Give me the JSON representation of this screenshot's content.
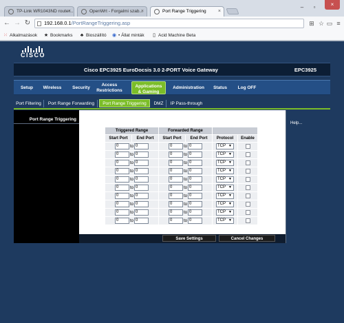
{
  "browser": {
    "tabs": [
      {
        "label": "TP-Link WR1043ND router..."
      },
      {
        "label": "OpenWrt - Forgalmi szab..."
      },
      {
        "label": "Port Range Triggering"
      }
    ],
    "url_host": "192.168.0.1",
    "url_path": "/PortRangeTriggering.asp",
    "bookmarks": [
      "Alkalmazások",
      "Bookmarks",
      "Bioszállító",
      "• Állat minták",
      "Acid Machine Beta"
    ]
  },
  "header": {
    "title": "Cisco EPC3925 EuroDocsis 3.0 2-PORT Voice Gateway",
    "model": "EPC3925",
    "logo": "CISCO"
  },
  "main_nav": [
    {
      "line1": "Setup",
      "line2": ""
    },
    {
      "line1": "Wireless",
      "line2": ""
    },
    {
      "line1": "Security",
      "line2": ""
    },
    {
      "line1": "Access",
      "line2": "Restrictions"
    },
    {
      "line1": "Applications",
      "line2": "& Gaming"
    },
    {
      "line1": "Administration",
      "line2": ""
    },
    {
      "line1": "Status",
      "line2": ""
    },
    {
      "line1": "Log OFF",
      "line2": ""
    }
  ],
  "sub_nav": [
    "Port Filtering",
    "Port Range Forwarding",
    "Port Range Triggering",
    "DMZ",
    "IP Pass-through"
  ],
  "section_title": "Port Range Triggering",
  "help": "Help...",
  "table": {
    "group_headers": [
      "Triggered Range",
      "Forwarded Range"
    ],
    "columns": [
      "Start Port",
      "End Port",
      "Start Port",
      "End Port",
      "Protocol",
      "Enable"
    ],
    "to_label": "to",
    "rows": [
      {
        "ts": "0",
        "te": "0",
        "fs": "0",
        "fe": "0",
        "protocol": "TCP"
      },
      {
        "ts": "0",
        "te": "0",
        "fs": "0",
        "fe": "0",
        "protocol": "TCP"
      },
      {
        "ts": "0",
        "te": "0",
        "fs": "0",
        "fe": "0",
        "protocol": "TCP"
      },
      {
        "ts": "0",
        "te": "0",
        "fs": "0",
        "fe": "0",
        "protocol": "TCP"
      },
      {
        "ts": "0",
        "te": "0",
        "fs": "0",
        "fe": "0",
        "protocol": "TCP"
      },
      {
        "ts": "0",
        "te": "0",
        "fs": "0",
        "fe": "0",
        "protocol": "TCP"
      },
      {
        "ts": "0",
        "te": "0",
        "fs": "0",
        "fe": "0",
        "protocol": "TCP"
      },
      {
        "ts": "0",
        "te": "0",
        "fs": "0",
        "fe": "0",
        "protocol": "TCP"
      },
      {
        "ts": "0",
        "te": "0",
        "fs": "0",
        "fe": "0",
        "protocol": "TCP"
      },
      {
        "ts": "0",
        "te": "0",
        "fs": "0",
        "fe": "0",
        "protocol": "TCP"
      }
    ]
  },
  "actions": {
    "save": "Save Settings",
    "cancel": "Cancel Changes"
  }
}
